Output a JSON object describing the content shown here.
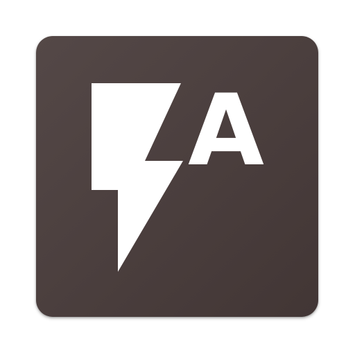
{
  "app_icon": {
    "letter": "A",
    "background_color": "#4a3e3d",
    "background_color_light": "#544847",
    "background_color_dark": "#423635",
    "foreground_color": "#ffffff",
    "glyph": "lightning-bolt-icon"
  }
}
